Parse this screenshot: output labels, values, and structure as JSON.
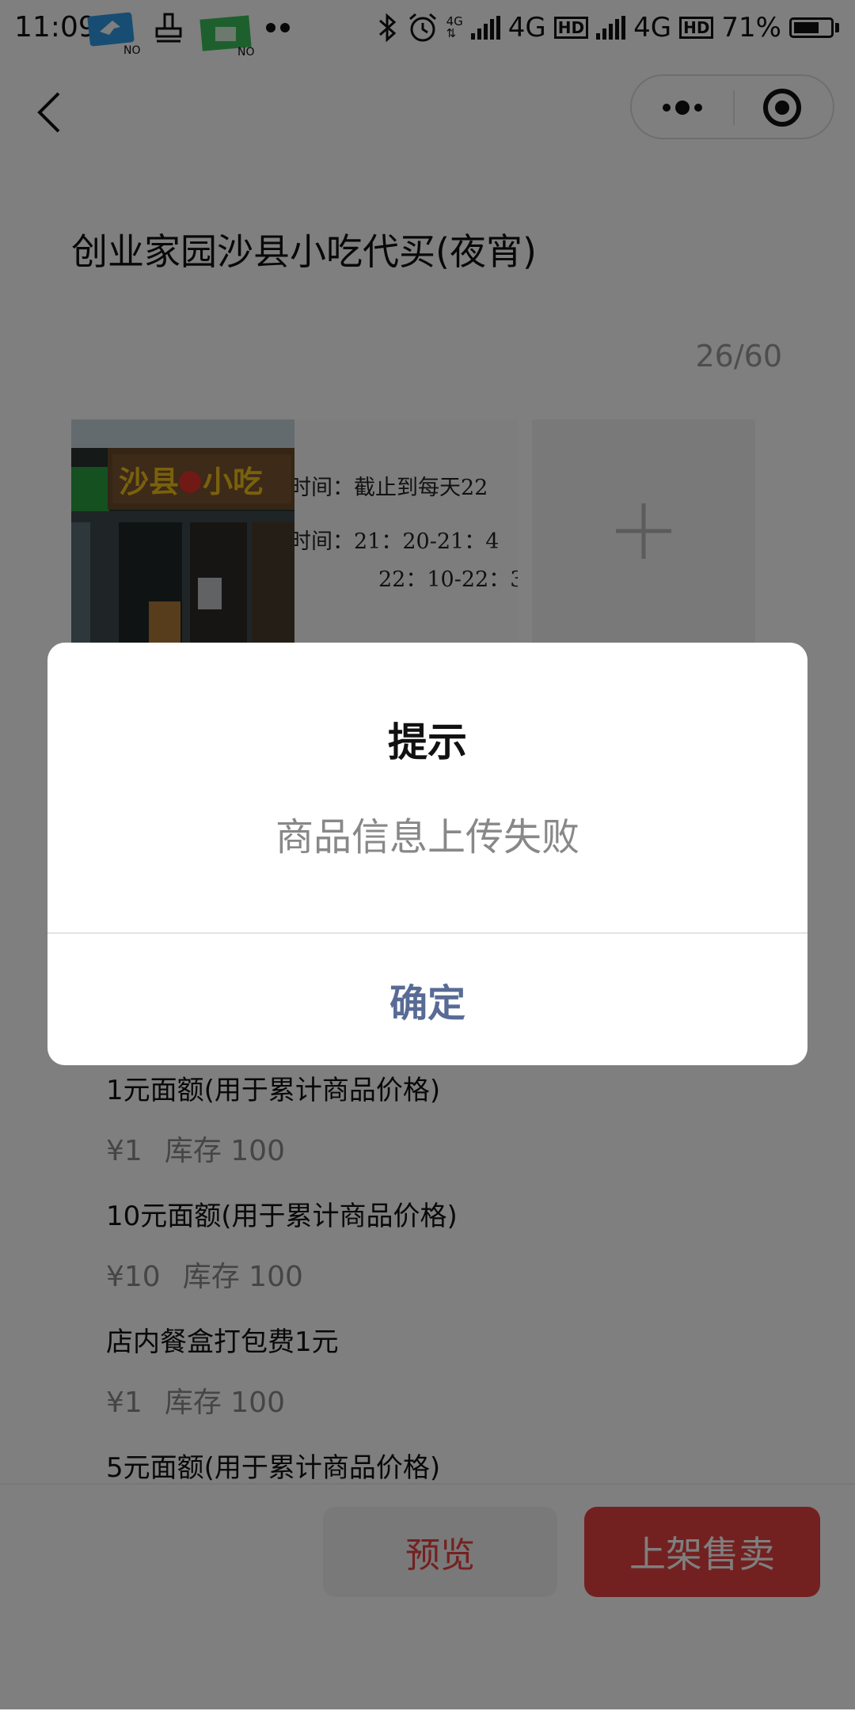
{
  "status_bar": {
    "time": "11:09",
    "network_1": "4G",
    "network_2": "4G",
    "signal_small": "4G",
    "hd": "HD",
    "battery_percent": "71%",
    "battery_level": 0.71,
    "notification_badge": "NO"
  },
  "nav": {
    "more_icon": "more-dots-icon",
    "close_icon": "target-close-icon"
  },
  "form": {
    "title": "创业家园沙县小吃代买(夜宵)",
    "char_counter": "26/60"
  },
  "images": {
    "shop_sign": "沙县",
    "shop_sign_2": "小吃",
    "text_line_1": "时间：截止到每天22",
    "text_line_2": "时间：21：20-21：4",
    "text_line_3": "22：10-22：3",
    "add_icon": "plus-icon"
  },
  "specs": [
    {
      "name": "1元面额(用于累计商品价格)",
      "price": "¥1",
      "stock": "库存 100"
    },
    {
      "name": "10元面额(用于累计商品价格)",
      "price": "¥10",
      "stock": "库存 100"
    },
    {
      "name": "店内餐盒打包费1元",
      "price": "¥1",
      "stock": "库存 100"
    },
    {
      "name": "5元面额(用于累计商品价格)"
    }
  ],
  "bottom": {
    "preview_label": "预览",
    "publish_label": "上架售卖"
  },
  "dialog": {
    "title": "提示",
    "message": "商品信息上传失败",
    "confirm_label": "确定",
    "accent": "#576b95"
  },
  "colors": {
    "primary_red": "#e64340",
    "mask": "rgba(0,0,0,0.5)"
  }
}
